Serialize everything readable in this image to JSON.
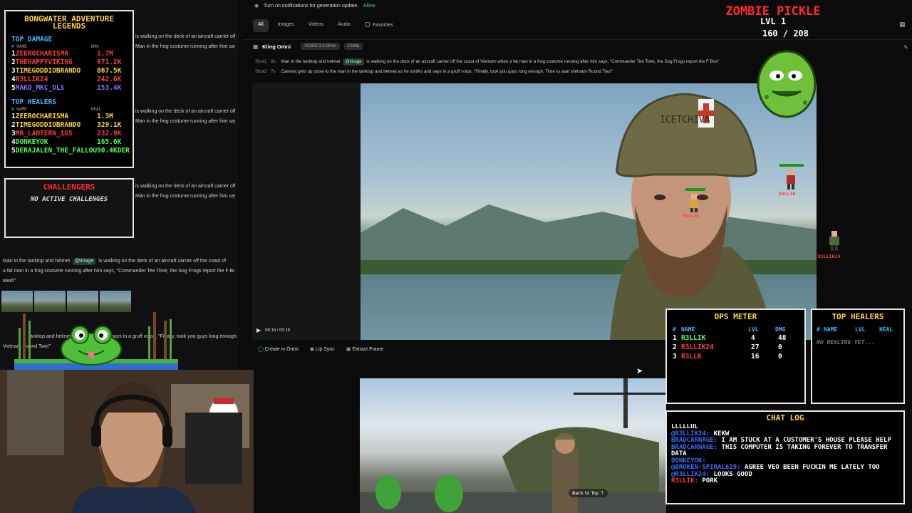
{
  "topbar": {
    "notify_text": "Turn on notifications for generation update.",
    "allow": "Allow"
  },
  "tabs": [
    {
      "label": "All",
      "active": true
    },
    {
      "label": "Images"
    },
    {
      "label": "Videos"
    },
    {
      "label": "Audio"
    }
  ],
  "favorites": "Favorites",
  "model": {
    "name": "Kling Omni",
    "badge_version": "VIDEO 3.0 Omni",
    "badge_res": "1080p"
  },
  "shots": [
    {
      "label": "Shot1",
      "dur": "8s",
      "pre": "Man in the tanktop and helmet",
      "mention": "@image",
      "post": "is walking on the deck of an aircraft carrier off the coast of Vietnam when a fat man in a frog costume running after him says, \"Commander Tee Tone, the Sog Frogs report the F Box\""
    },
    {
      "label": "Shot2",
      "dur": "7s",
      "pre": "Camera gets up close to the man in the tanktop and helmet as he smirks and says in a gruff voice, \"Finally, took you guys long enough. Time to start Vietnam Round Two!\"",
      "mention": "",
      "post": ""
    }
  ],
  "video": {
    "time": "00:15 / 00:15",
    "helmet_text": "ICETCHIVA"
  },
  "actions": {
    "create": "Create in Omni",
    "lipsync": "Lip Sync",
    "extract": "Extract Frame"
  },
  "back_to_top": "Back to Top",
  "left_history": [
    {
      "text": "is walking on the deck of an aircraft carrier off the coast of"
    },
    {
      "text": "Man in the frog costume running after him says, \"Commander Tee Tone, the Sog Frogs report the F Box"
    },
    {
      "text": "is walking on the deck of an aircraft carrier off the coast of"
    },
    {
      "text": "Man in the frog costume running after him says, \"Commander Tee Tone, the Sog Frogs report the F Box"
    },
    {
      "text": "Man in the tanktop and helmet",
      "mention": "@image",
      "tail": "is walking on the deck of an aircraft carrier off the coast of"
    },
    {
      "text": "a fat man in a frog costume running after him says, \"Commander Tee Tone, the Sog Frogs report the F Box"
    },
    {
      "text": "ated!\""
    },
    {
      "text": "tanktop and helmet as he smirks and says in a gruff voice, \"Finally, took you guys long enough."
    },
    {
      "text": "Vietnam Round Two!\""
    }
  ],
  "legends": {
    "title": "BONGWATER ADVENTURE LEGENDS",
    "top_damage": "TOP DAMAGE",
    "dmg_header": {
      "name": "# NAME",
      "val": "DMG"
    },
    "damage": [
      {
        "rank": "1",
        "name": "ZEEROCHARISMA",
        "val": "1.7M",
        "color": "#ff3b3b"
      },
      {
        "rank": "2",
        "name": "THEHAPPYVIKING",
        "val": "971.2K",
        "color": "#ff3b3b"
      },
      {
        "rank": "3",
        "name": "TIMEGODDIOBRANDO",
        "val": "867.5K",
        "color": "#ffd23b"
      },
      {
        "rank": "4",
        "name": "R3LLIK24",
        "val": "242.6K",
        "color": "#ff3b3b"
      },
      {
        "rank": "5",
        "name": "MAKO_MKC_DLS",
        "val": "153.4K",
        "color": "#8a6cff"
      }
    ],
    "top_healers": "TOP HEALERS",
    "heal_header": {
      "name": "# NAME",
      "val": "HEAL"
    },
    "healers": [
      {
        "rank": "1",
        "name": "ZEEROCHARISMA",
        "val": "1.3M",
        "color": "#ffd23b"
      },
      {
        "rank": "2",
        "name": "TIMEGODDIOBRANDO",
        "val": "329.1K",
        "color": "#ffd23b"
      },
      {
        "rank": "3",
        "name": "MR_LANTERN_1GS",
        "val": "232.9K",
        "color": "#ff3b3b"
      },
      {
        "rank": "4",
        "name": "DONKEYOK",
        "val": "165.6K",
        "color": "#4cff4c"
      },
      {
        "rank": "5",
        "name": "DERAJALEN_THE_FALLOUT_MODDER",
        "val": "90.4K",
        "color": "#4cff4c"
      }
    ]
  },
  "challengers": {
    "title": "CHALLENGERS",
    "empty": "NO ACTIVE CHALLENGES"
  },
  "boss": {
    "name": "ZOMBIE PICKLE",
    "level": "LVL 1",
    "hp": "160 / 208"
  },
  "sprites": [
    {
      "name": "R3LLIK"
    },
    {
      "name": "R3LLIK"
    },
    {
      "name": "R3LLIK24"
    }
  ],
  "dps": {
    "title": "DPS METER",
    "headers": {
      "num": "#",
      "name": "NAME",
      "lvl": "LVL",
      "dmg": "DMG"
    },
    "rows": [
      {
        "rank": "1",
        "name": "R3LLIK",
        "lvl": "4",
        "dmg": "48",
        "color": "#4cff4c"
      },
      {
        "rank": "2",
        "name": "R3LLIK24",
        "lvl": "27",
        "dmg": "0",
        "color": "#ff3b3b"
      },
      {
        "rank": "3",
        "name": "R3LLK",
        "lvl": "16",
        "dmg": "0",
        "color": "#ff3b3b"
      }
    ]
  },
  "healers_panel": {
    "title": "TOP HEALERS",
    "headers": {
      "num": "#",
      "name": "NAME",
      "lvl": "LVL",
      "heal": "HEAL"
    },
    "empty": "NO HEALING YET..."
  },
  "chat": {
    "title": "CHAT LOG",
    "lines": [
      {
        "user": "",
        "text": "LLLLLUL",
        "ucolor": "#fff"
      },
      {
        "user": "@R3LLIK24:",
        "text": "KEKW",
        "ucolor": "#3b6bff"
      },
      {
        "user": "BRADCARNAGE:",
        "text": "I AM STUCK AT A CUSTOMER'S HOUSE PLEASE HELP",
        "ucolor": "#3b6bff"
      },
      {
        "user": "BRADCARNAGE:",
        "text": "THIS COMPUTER IS TAKING FOREVER TO TRANSFER DATA",
        "ucolor": "#3b6bff"
      },
      {
        "user": "DONKEYOK:",
        "text": "",
        "ucolor": "#3b6bff"
      },
      {
        "user": "@BROKEN-SPIRAL619:",
        "text": "AGREE VEO BEEN FUCKIN ME LATELY TOO",
        "ucolor": "#3b6bff"
      },
      {
        "user": "@R3LLIK24:",
        "text": "LOOKS GOOD",
        "ucolor": "#3b6bff"
      },
      {
        "user": "R3LLIK:",
        "text": "PORK",
        "ucolor": "#ff3b3b"
      }
    ]
  }
}
